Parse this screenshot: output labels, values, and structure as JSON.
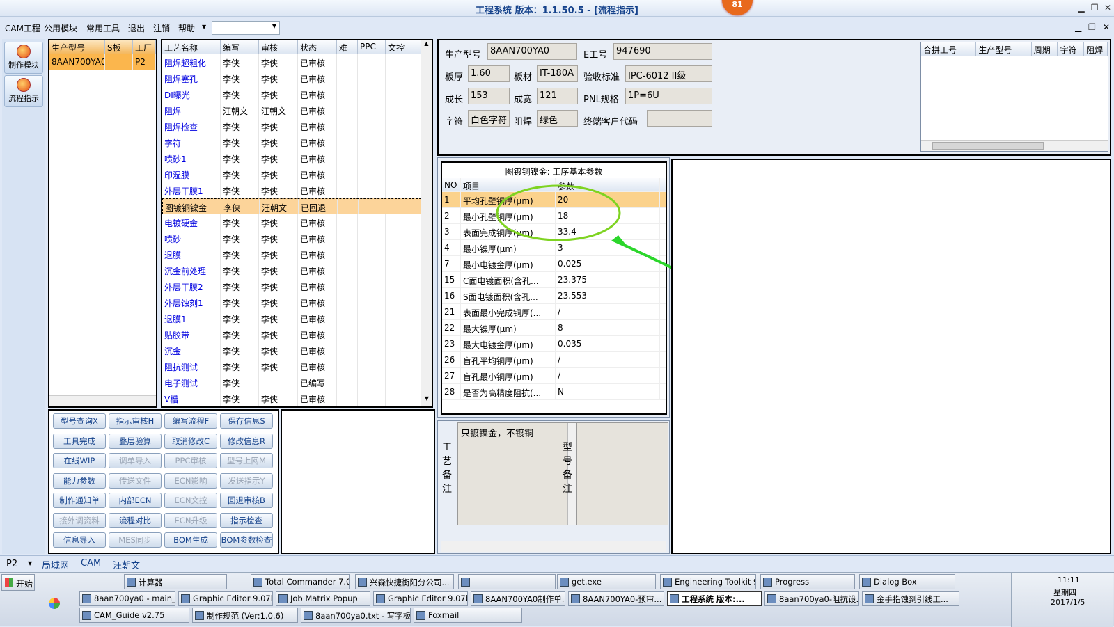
{
  "window": {
    "title": "工程系统   版本：1.1.50.5 - [流程指示]",
    "badge": "81"
  },
  "menu": {
    "items": [
      "CAM工程",
      "公用模块",
      "常用工具",
      "退出",
      "注销",
      "帮助"
    ],
    "combo_value": ""
  },
  "leftnav": {
    "items": [
      "制作模块",
      "流程指示"
    ]
  },
  "product_grid": {
    "headers": [
      "生产型号",
      "S板",
      "工厂"
    ],
    "rows": [
      [
        "8AAN700YA0",
        "",
        "P2"
      ]
    ]
  },
  "process_grid": {
    "headers": [
      "工艺名称",
      "编写",
      "审核",
      "状态",
      "难",
      "PPC",
      "文控"
    ],
    "rows": [
      [
        "阻焊超粗化",
        "李侠",
        "李侠",
        "已审核"
      ],
      [
        "阻焊塞孔",
        "李侠",
        "李侠",
        "已审核"
      ],
      [
        "DI曝光",
        "李侠",
        "李侠",
        "已审核"
      ],
      [
        "阻焊",
        "汪朝文",
        "汪朝文",
        "已审核"
      ],
      [
        "阻焊检查",
        "李侠",
        "李侠",
        "已审核"
      ],
      [
        "字符",
        "李侠",
        "李侠",
        "已审核"
      ],
      [
        "喷砂1",
        "李侠",
        "李侠",
        "已审核"
      ],
      [
        "印湿膜",
        "李侠",
        "李侠",
        "已审核"
      ],
      [
        "外层干膜1",
        "李侠",
        "李侠",
        "已审核"
      ],
      [
        "图镀铜镍金",
        "李侠",
        "汪朝文",
        "已回退"
      ],
      [
        "电镀硬金",
        "李侠",
        "李侠",
        "已审核"
      ],
      [
        "喷砂",
        "李侠",
        "李侠",
        "已审核"
      ],
      [
        "退膜",
        "李侠",
        "李侠",
        "已审核"
      ],
      [
        "沉金前处理",
        "李侠",
        "李侠",
        "已审核"
      ],
      [
        "外层干膜2",
        "李侠",
        "李侠",
        "已审核"
      ],
      [
        "外层蚀刻1",
        "李侠",
        "李侠",
        "已审核"
      ],
      [
        "退膜1",
        "李侠",
        "李侠",
        "已审核"
      ],
      [
        "贴胶带",
        "李侠",
        "李侠",
        "已审核"
      ],
      [
        "沉金",
        "李侠",
        "李侠",
        "已审核"
      ],
      [
        "阻抗测试",
        "李侠",
        "李侠",
        "已审核"
      ],
      [
        "电子测试",
        "李侠",
        "",
        "已编写"
      ],
      [
        "V槽",
        "李侠",
        "李侠",
        "已审核"
      ]
    ],
    "selected_index": 9
  },
  "function_buttons": [
    [
      "型号查询X",
      "指示审核H",
      "编写流程F",
      "保存信息S"
    ],
    [
      "工具完成",
      "叠层验算",
      "取消修改C",
      "修改信息R"
    ],
    [
      "在线WIP",
      "调单导入",
      "PPC审核",
      "型号上网M"
    ],
    [
      "能力参数",
      "传送文件",
      "ECN影响",
      "发送指示Y"
    ],
    [
      "制作通知单",
      "内部ECN",
      "ECN文控",
      "回退审核B"
    ],
    [
      "接外调资料",
      "流程对比",
      "ECN升级",
      "指示检查"
    ],
    [
      "信息导入",
      "MES同步",
      "BOM生成",
      "BOM参数检查"
    ]
  ],
  "function_buttons_disabled": [
    "调单导入",
    "PPC审核",
    "型号上网M",
    "传送文件",
    "ECN影响",
    "发送指示Y",
    "ECN文控",
    "接外调资料",
    "ECN升级",
    "MES同步"
  ],
  "info": {
    "label_product": "生产型号",
    "product": "8AAN700YA0",
    "label_eno": "E工号",
    "eno": "947690",
    "label_thick": "板厚",
    "thick": "1.60",
    "label_material": "板材",
    "material": "IT-180A",
    "label_std": "验收标准",
    "std": "IPC-6012 II级",
    "label_len": "成长",
    "len": "153",
    "label_wid": "成宽",
    "wid": "121",
    "label_pnl": "PNL规格",
    "pnl": "1P=6U",
    "label_char": "字符",
    "char": "白色字符",
    "label_mask": "阻焊",
    "mask": "绿色",
    "label_customer": "终端客户代码",
    "customer": ""
  },
  "merge_grid": {
    "headers": [
      "合拼工号",
      "生产型号",
      "周期",
      "字符",
      "阻焊"
    ]
  },
  "params": {
    "title": "图镀铜镍金: 工序基本参数",
    "headers": [
      "NO",
      "项目",
      "参数"
    ],
    "rows": [
      [
        "1",
        "平均孔壁铜厚(μm)",
        "20"
      ],
      [
        "2",
        "最小孔壁铜厚(μm)",
        "18"
      ],
      [
        "3",
        "表面完成铜厚(μm)",
        "33.4"
      ],
      [
        "4",
        "最小镍厚(μm)",
        "3"
      ],
      [
        "7",
        "最小电镀金厚(μm)",
        "0.025"
      ],
      [
        "15",
        "C面电镀面积(含孔...",
        "23.375"
      ],
      [
        "16",
        "S面电镀面积(含孔...",
        "23.553"
      ],
      [
        "21",
        "表面最小完成铜厚(...",
        "/"
      ],
      [
        "22",
        "最大镍厚(μm)",
        "8"
      ],
      [
        "23",
        "最大电镀金厚(μm)",
        "0.035"
      ],
      [
        "26",
        "盲孔平均铜厚(μm)",
        "/"
      ],
      [
        "27",
        "盲孔最小铜厚(μm)",
        "/"
      ],
      [
        "28",
        "是否为高精度阻抗(...",
        "N"
      ]
    ]
  },
  "notes": {
    "craft_label": "工艺备注",
    "craft_text": "只镀镍金，不镀铜",
    "model_label": "型号备注",
    "model_text": ""
  },
  "status": {
    "factory": "P2",
    "tabs": [
      "局域网",
      "CAM",
      "汪朝文"
    ]
  },
  "taskbar": {
    "start": "开始",
    "row1": [
      "计算器",
      "Total Commander 7.0 ...",
      "兴森快捷衡阳分公司...",
      "",
      "get.exe",
      "Engineering Toolkit 9....",
      "Progress",
      "Dialog Box"
    ],
    "row2": [
      "8aan700ya0 - main_qa",
      "Graphic Editor 9.07b2...",
      "Job Matrix Popup",
      "Graphic Editor 9.07b...",
      "8AAN700YA0制作单....",
      "8AAN700YA0-预审...",
      "工程系统  版本:...",
      "8aan700ya0-阻抗设...",
      "金手指蚀刻引线工..."
    ],
    "row3": [
      "CAM_Guide v2.75",
      "制作规范 (Ver:1.0.6)",
      "8aan700ya0.txt - 写字板",
      "Foxmail"
    ],
    "clock_time": "11:11",
    "clock_day": "星期四",
    "clock_date": "2017/1/5"
  }
}
